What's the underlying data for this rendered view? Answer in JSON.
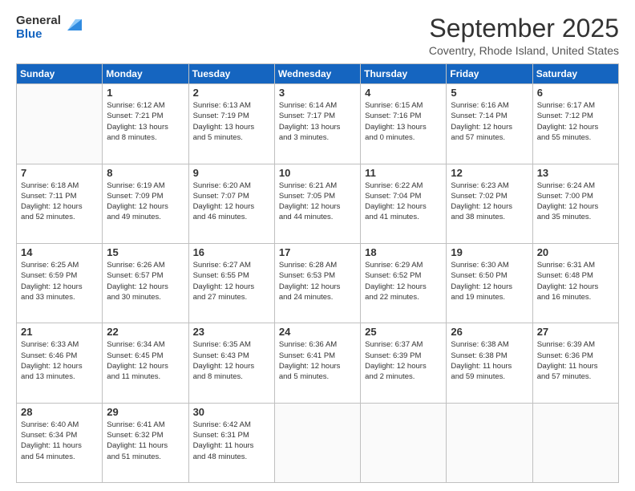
{
  "logo": {
    "general": "General",
    "blue": "Blue"
  },
  "header": {
    "month": "September 2025",
    "location": "Coventry, Rhode Island, United States"
  },
  "weekdays": [
    "Sunday",
    "Monday",
    "Tuesday",
    "Wednesday",
    "Thursday",
    "Friday",
    "Saturday"
  ],
  "weeks": [
    [
      {
        "day": "",
        "info": ""
      },
      {
        "day": "1",
        "info": "Sunrise: 6:12 AM\nSunset: 7:21 PM\nDaylight: 13 hours\nand 8 minutes."
      },
      {
        "day": "2",
        "info": "Sunrise: 6:13 AM\nSunset: 7:19 PM\nDaylight: 13 hours\nand 5 minutes."
      },
      {
        "day": "3",
        "info": "Sunrise: 6:14 AM\nSunset: 7:17 PM\nDaylight: 13 hours\nand 3 minutes."
      },
      {
        "day": "4",
        "info": "Sunrise: 6:15 AM\nSunset: 7:16 PM\nDaylight: 13 hours\nand 0 minutes."
      },
      {
        "day": "5",
        "info": "Sunrise: 6:16 AM\nSunset: 7:14 PM\nDaylight: 12 hours\nand 57 minutes."
      },
      {
        "day": "6",
        "info": "Sunrise: 6:17 AM\nSunset: 7:12 PM\nDaylight: 12 hours\nand 55 minutes."
      }
    ],
    [
      {
        "day": "7",
        "info": "Sunrise: 6:18 AM\nSunset: 7:11 PM\nDaylight: 12 hours\nand 52 minutes."
      },
      {
        "day": "8",
        "info": "Sunrise: 6:19 AM\nSunset: 7:09 PM\nDaylight: 12 hours\nand 49 minutes."
      },
      {
        "day": "9",
        "info": "Sunrise: 6:20 AM\nSunset: 7:07 PM\nDaylight: 12 hours\nand 46 minutes."
      },
      {
        "day": "10",
        "info": "Sunrise: 6:21 AM\nSunset: 7:05 PM\nDaylight: 12 hours\nand 44 minutes."
      },
      {
        "day": "11",
        "info": "Sunrise: 6:22 AM\nSunset: 7:04 PM\nDaylight: 12 hours\nand 41 minutes."
      },
      {
        "day": "12",
        "info": "Sunrise: 6:23 AM\nSunset: 7:02 PM\nDaylight: 12 hours\nand 38 minutes."
      },
      {
        "day": "13",
        "info": "Sunrise: 6:24 AM\nSunset: 7:00 PM\nDaylight: 12 hours\nand 35 minutes."
      }
    ],
    [
      {
        "day": "14",
        "info": "Sunrise: 6:25 AM\nSunset: 6:59 PM\nDaylight: 12 hours\nand 33 minutes."
      },
      {
        "day": "15",
        "info": "Sunrise: 6:26 AM\nSunset: 6:57 PM\nDaylight: 12 hours\nand 30 minutes."
      },
      {
        "day": "16",
        "info": "Sunrise: 6:27 AM\nSunset: 6:55 PM\nDaylight: 12 hours\nand 27 minutes."
      },
      {
        "day": "17",
        "info": "Sunrise: 6:28 AM\nSunset: 6:53 PM\nDaylight: 12 hours\nand 24 minutes."
      },
      {
        "day": "18",
        "info": "Sunrise: 6:29 AM\nSunset: 6:52 PM\nDaylight: 12 hours\nand 22 minutes."
      },
      {
        "day": "19",
        "info": "Sunrise: 6:30 AM\nSunset: 6:50 PM\nDaylight: 12 hours\nand 19 minutes."
      },
      {
        "day": "20",
        "info": "Sunrise: 6:31 AM\nSunset: 6:48 PM\nDaylight: 12 hours\nand 16 minutes."
      }
    ],
    [
      {
        "day": "21",
        "info": "Sunrise: 6:33 AM\nSunset: 6:46 PM\nDaylight: 12 hours\nand 13 minutes."
      },
      {
        "day": "22",
        "info": "Sunrise: 6:34 AM\nSunset: 6:45 PM\nDaylight: 12 hours\nand 11 minutes."
      },
      {
        "day": "23",
        "info": "Sunrise: 6:35 AM\nSunset: 6:43 PM\nDaylight: 12 hours\nand 8 minutes."
      },
      {
        "day": "24",
        "info": "Sunrise: 6:36 AM\nSunset: 6:41 PM\nDaylight: 12 hours\nand 5 minutes."
      },
      {
        "day": "25",
        "info": "Sunrise: 6:37 AM\nSunset: 6:39 PM\nDaylight: 12 hours\nand 2 minutes."
      },
      {
        "day": "26",
        "info": "Sunrise: 6:38 AM\nSunset: 6:38 PM\nDaylight: 11 hours\nand 59 minutes."
      },
      {
        "day": "27",
        "info": "Sunrise: 6:39 AM\nSunset: 6:36 PM\nDaylight: 11 hours\nand 57 minutes."
      }
    ],
    [
      {
        "day": "28",
        "info": "Sunrise: 6:40 AM\nSunset: 6:34 PM\nDaylight: 11 hours\nand 54 minutes."
      },
      {
        "day": "29",
        "info": "Sunrise: 6:41 AM\nSunset: 6:32 PM\nDaylight: 11 hours\nand 51 minutes."
      },
      {
        "day": "30",
        "info": "Sunrise: 6:42 AM\nSunset: 6:31 PM\nDaylight: 11 hours\nand 48 minutes."
      },
      {
        "day": "",
        "info": ""
      },
      {
        "day": "",
        "info": ""
      },
      {
        "day": "",
        "info": ""
      },
      {
        "day": "",
        "info": ""
      }
    ]
  ]
}
